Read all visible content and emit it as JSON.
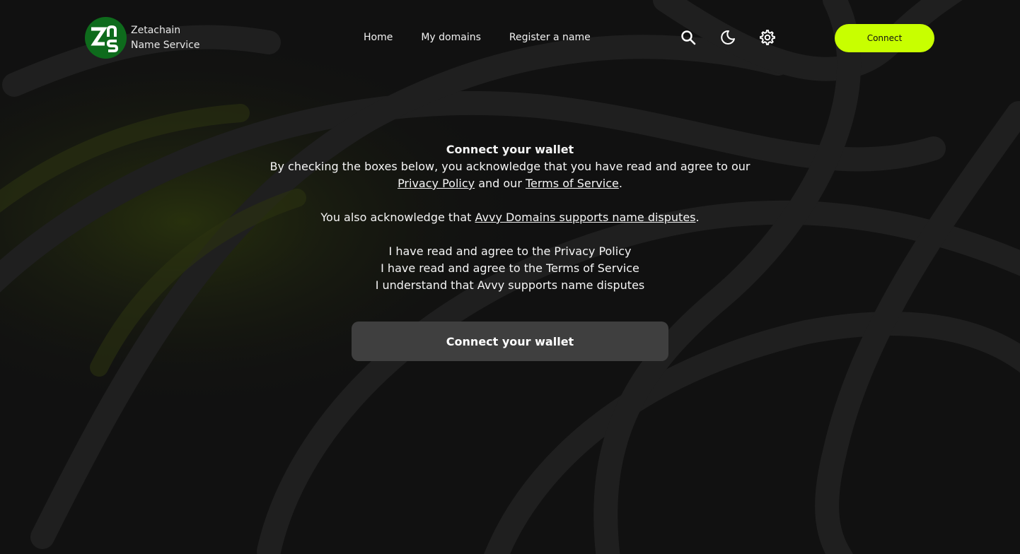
{
  "header": {
    "logo": {
      "mark_letters": "Zns",
      "line1": "Zetachain",
      "line2": "Name Service"
    },
    "nav": [
      {
        "label": "Home"
      },
      {
        "label": "My domains"
      },
      {
        "label": "Register a name"
      }
    ],
    "icons": [
      "search-icon",
      "moon-icon",
      "gear-icon"
    ],
    "connect_label": "Connect"
  },
  "colors": {
    "accent": "#c8ff00",
    "background": "#111111",
    "logo_bg": "#0e6b1c",
    "button_bg": "#3f3f3f"
  },
  "main": {
    "title": "Connect your wallet",
    "intro": "By checking the boxes below, you acknowledge that you have read and agree to our",
    "privacy_link": "Privacy Policy",
    "and_our": " and our ",
    "terms_link": "Terms of Service",
    "period": ".",
    "also_prefix": "You also acknowledge that ",
    "disputes_link": "Avvy Domains supports name disputes",
    "checks": [
      "I have read and agree to the Privacy Policy",
      "I have read and agree to the Terms of Service",
      "I understand that Avvy supports name disputes"
    ],
    "button_label": "Connect your wallet"
  }
}
